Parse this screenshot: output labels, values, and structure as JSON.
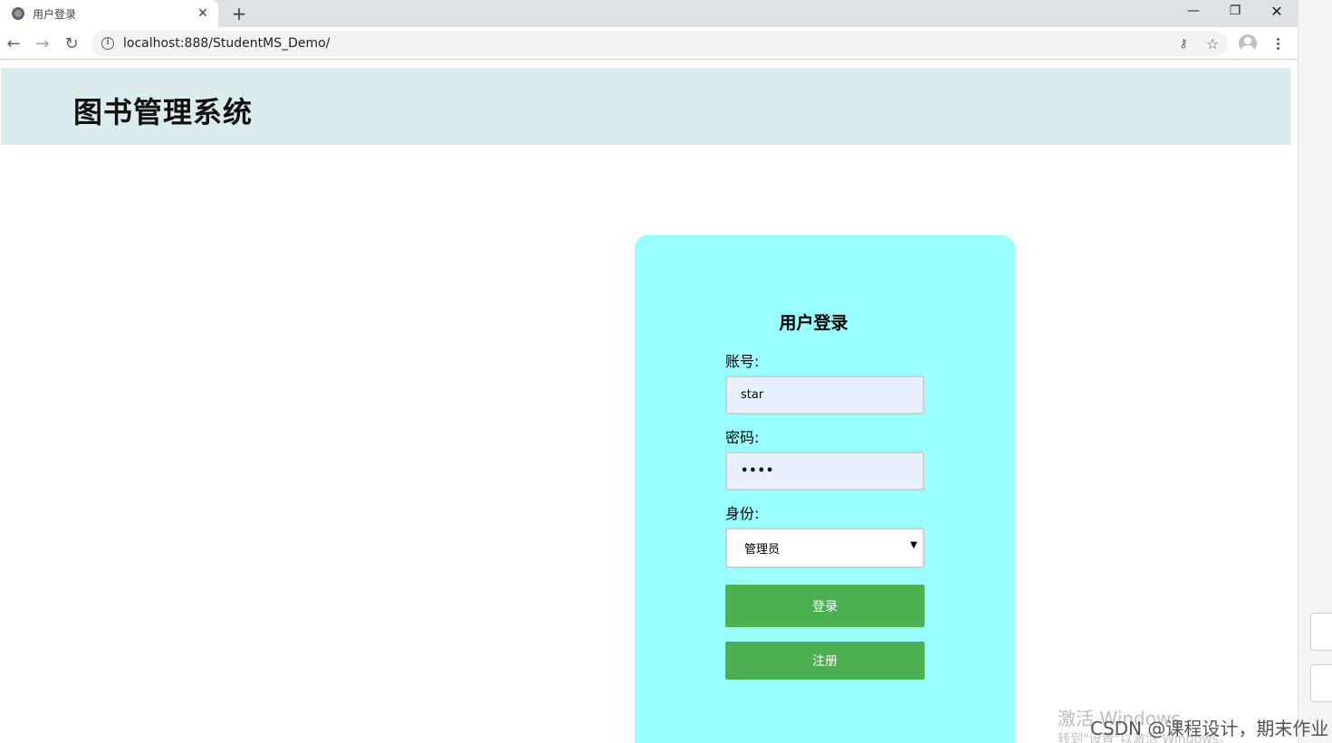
{
  "browser": {
    "tab_title": "用户登录",
    "tab_close": "✕",
    "new_tab": "+",
    "url": "localhost:888/StudentMS_Demo/",
    "window_controls": {
      "minimize": "—",
      "maximize": "❐",
      "close": "✕"
    },
    "icons": [
      "globe-icon",
      "back-icon",
      "forward-icon",
      "reload-icon",
      "info-icon",
      "key-icon",
      "star-icon",
      "profile-icon",
      "menu-icon"
    ]
  },
  "header": {
    "title": "图书管理系统"
  },
  "login": {
    "title": "用户登录",
    "account_label": "账号:",
    "account_value": "star",
    "password_label": "密码:",
    "password_value": "••••",
    "role_label": "身份:",
    "role_value": "管理员",
    "login_button": "登录",
    "register_button": "注册"
  },
  "colors": {
    "header_bg": "#daeced",
    "card_bg": "#99ffff",
    "button_bg": "#4caf50",
    "input_bg": "#e8f0fe"
  },
  "overlay": {
    "activate_windows": "激活 Windows",
    "activate_hint": "转到\"设置\"以激活 Windows。",
    "csdn_watermark": "CSDN @课程设计，期末作业"
  }
}
